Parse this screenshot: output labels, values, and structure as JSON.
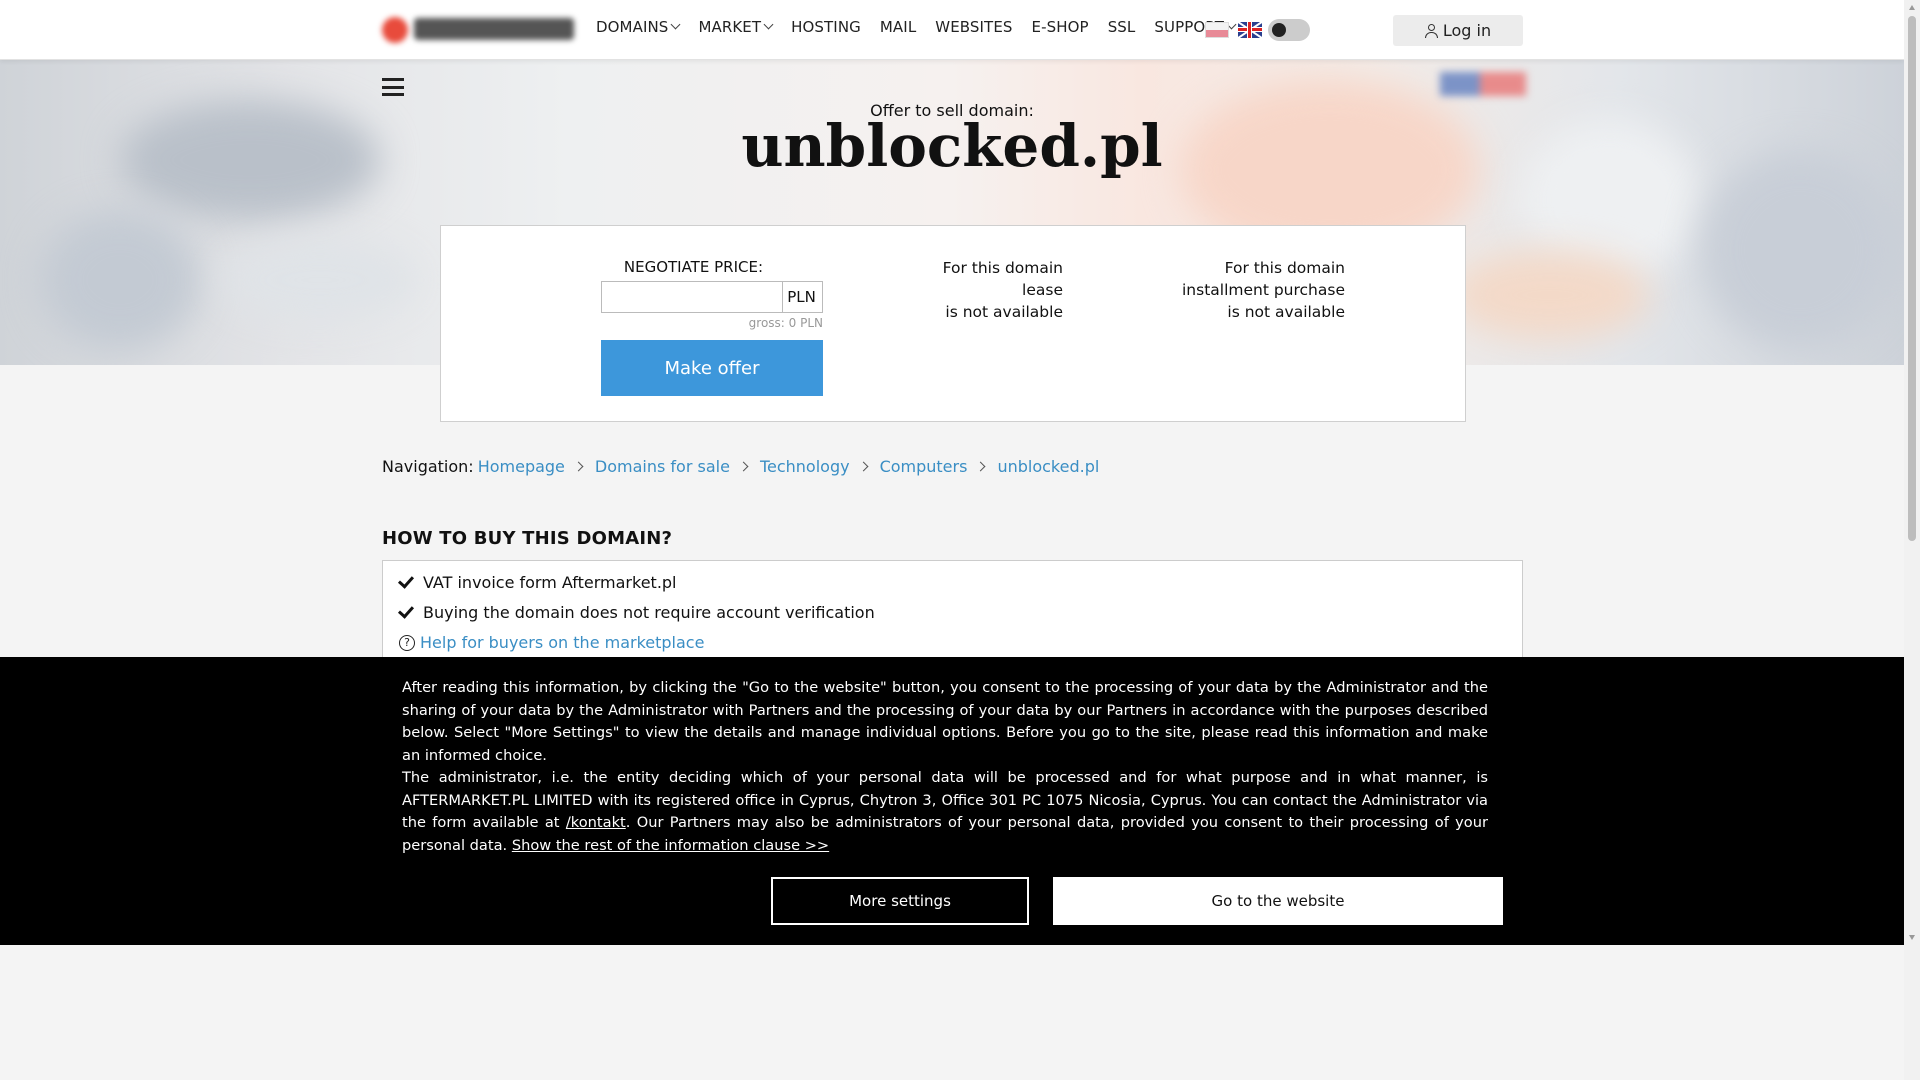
{
  "header": {
    "nav": [
      {
        "label": "DOMAINS",
        "dropdown": true
      },
      {
        "label": "MARKET",
        "dropdown": true
      },
      {
        "label": "HOSTING",
        "dropdown": false
      },
      {
        "label": "MAIL",
        "dropdown": false
      },
      {
        "label": "WEBSITES",
        "dropdown": false
      },
      {
        "label": "E-SHOP",
        "dropdown": false
      },
      {
        "label": "SSL",
        "dropdown": false
      },
      {
        "label": "SUPPORT",
        "dropdown": true
      }
    ],
    "login_label": "Log in",
    "theme_toggle": "dark-mode-off",
    "languages": [
      "pl-flag-icon",
      "uk-flag-icon"
    ]
  },
  "hero": {
    "offer_label": "Offer to sell domain:",
    "domain": "unblocked.pl"
  },
  "offer": {
    "negotiate_label": "NEGOTIATE PRICE:",
    "price_value": "",
    "currency": "PLN",
    "gross_text": "gross: 0 PLN",
    "make_offer_label": "Make offer",
    "lease": {
      "line1": "For this domain",
      "line2": "lease",
      "line3": "is not available"
    },
    "installment": {
      "line1": "For this domain",
      "line2": "installment purchase",
      "line3": "is not available"
    }
  },
  "breadcrumb": {
    "label": "Navigation:",
    "items": [
      "Homepage",
      "Domains for sale",
      "Technology",
      "Computers",
      "unblocked.pl"
    ]
  },
  "howto": {
    "title": "HOW TO BUY THIS DOMAIN?",
    "items": [
      "VAT invoice form Aftermarket.pl",
      "Buying the domain does not require account verification"
    ],
    "help_link": "Help for buyers on the marketplace"
  },
  "consent": {
    "para1": "After reading this information, by clicking the \"Go to the website\" button, you consent to the processing of your data by the Administrator and the sharing of your data by the Administrator with Partners and the processing of your data by our Partners in accordance with the purposes described below. Select \"More Settings\" to view the details and manage individual options. Before you go to the site, please read this information and make an informed choice.",
    "para2_start": "The administrator, i.e. the entity deciding which of your personal data will be processed and for what purpose and in what manner, is AFTERMARKET.PL LIMITED with its registered office in Cyprus, Chytron 3, Office 301 PC 1075 Nicosia, Cyprus. You can contact the Administrator via the form available at ",
    "contact_link": "/kontakt",
    "para2_mid": ". Our Partners may also be administrators of your personal data, provided you consent to their processing of your personal data. ",
    "rest_link": "Show the rest of the information clause >>",
    "more_settings": "More settings",
    "go_to_website": "Go to the website"
  },
  "colors": {
    "accent": "#3d97db",
    "link": "#3a8ec4",
    "consent_bg": "#000000"
  }
}
